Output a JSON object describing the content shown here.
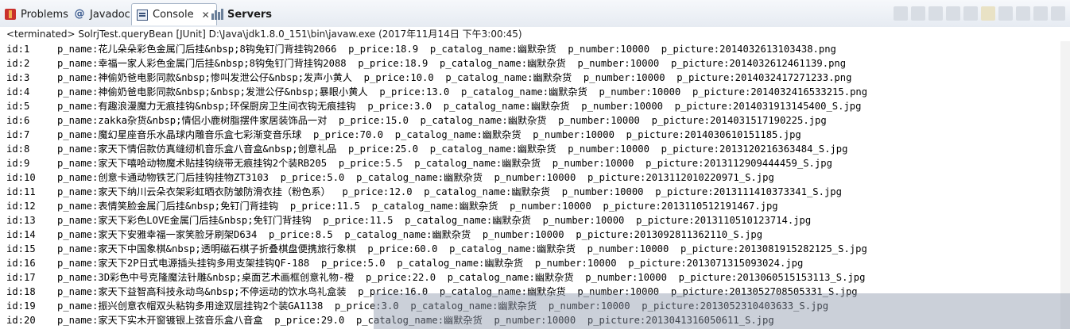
{
  "tabs": [
    {
      "label": "Problems",
      "icon": "problems-icon"
    },
    {
      "label": "Javadoc",
      "icon": "at-icon"
    },
    {
      "label": "Console",
      "icon": "console-icon",
      "active": true
    },
    {
      "label": "Servers",
      "icon": "servers-icon"
    }
  ],
  "status": "<terminated> SolrjTest.queryBean [JUnit] D:\\Java\\jdk1.8.0_151\\bin\\javaw.exe (2017年11月14日 下午3:00:45)",
  "rows": [
    {
      "id": "id:1",
      "name": "p_name:花儿朵朵彩色金属门后挂&nbsp;8钩兔钉门背挂钩2066",
      "price": "p_price:18.9",
      "catalog": "p_catalog_name:幽默杂货",
      "number": "p_number:10000",
      "picture": "p_picture:2014032613103438.png"
    },
    {
      "id": "id:2",
      "name": "p_name:幸福一家人彩色金属门后挂&nbsp;8钩兔钉门背挂钩2088",
      "price": "p_price:18.9",
      "catalog": "p_catalog_name:幽默杂货",
      "number": "p_number:10000",
      "picture": "p_picture:2014032612461139.png"
    },
    {
      "id": "id:3",
      "name": "p_name:神偷奶爸电影同款&nbsp;惨叫发泄公仔&nbsp;发声小黄人",
      "price": "p_price:10.0",
      "catalog": "p_catalog_name:幽默杂货",
      "number": "p_number:10000",
      "picture": "p_picture:2014032417271233.png"
    },
    {
      "id": "id:4",
      "name": "p_name:神偷奶爸电影同款&nbsp;&nbsp;发泄公仔&nbsp;暴眼小黄人",
      "price": "p_price:13.0",
      "catalog": "p_catalog_name:幽默杂货",
      "number": "p_number:10000",
      "picture": "p_picture:2014032416533215.png"
    },
    {
      "id": "id:5",
      "name": "p_name:有趣浪漫魔力无痕挂钩&nbsp;环保厨房卫生间衣钩无痕挂钩",
      "price": "p_price:3.0",
      "catalog": "p_catalog_name:幽默杂货",
      "number": "p_number:10000",
      "picture": "p_picture:2014031913145400_S.jpg"
    },
    {
      "id": "id:6",
      "name": "p_name:zakka杂货&nbsp;情侣小鹿树脂摆件家居装饰品一对",
      "price": "p_price:15.0",
      "catalog": "p_catalog_name:幽默杂货",
      "number": "p_number:10000",
      "picture": "p_picture:2014031517190225.jpg"
    },
    {
      "id": "id:7",
      "name": "p_name:魔幻星座音乐水晶球内雕音乐盒七彩渐变音乐球",
      "price": "p_price:70.0",
      "catalog": "p_catalog_name:幽默杂货",
      "number": "p_number:10000",
      "picture": "p_picture:2014030610151185.jpg"
    },
    {
      "id": "id:8",
      "name": "p_name:家天下情侣款仿真缝纫机音乐盒八音盒&nbsp;创意礼品",
      "price": "p_price:25.0",
      "catalog": "p_catalog_name:幽默杂货",
      "number": "p_number:10000",
      "picture": "p_picture:2013120216363484_S.jpg"
    },
    {
      "id": "id:9",
      "name": "p_name:家天下嘻哈动物魔术贴挂钩绕带无痕挂钩2个装RB205",
      "price": "p_price:5.5",
      "catalog": "p_catalog_name:幽默杂货",
      "number": "p_number:10000",
      "picture": "p_picture:2013112909444459_S.jpg"
    },
    {
      "id": "id:10",
      "name": "p_name:创意卡通动物铁艺门后挂钩挂物ZT3103",
      "price": "p_price:5.0",
      "catalog": "p_catalog_name:幽默杂货",
      "number": "p_number:10000",
      "picture": "p_picture:2013112010220971_S.jpg"
    },
    {
      "id": "id:11",
      "name": "p_name:家天下纳川云朵衣架彩虹晒衣防皱防滑衣挂（粉色系）",
      "price": "p_price:12.0",
      "catalog": "p_catalog_name:幽默杂货",
      "number": "p_number:10000",
      "picture": "p_picture:2013111410373341_S.jpg"
    },
    {
      "id": "id:12",
      "name": "p_name:表情笑脸金属门后挂&nbsp;免钉门背挂钩",
      "price": "p_price:11.5",
      "catalog": "p_catalog_name:幽默杂货",
      "number": "p_number:10000",
      "picture": "p_picture:2013110512191467.jpg"
    },
    {
      "id": "id:13",
      "name": "p_name:家天下彩色LOVE金属门后挂&nbsp;免钉门背挂钩",
      "price": "p_price:11.5",
      "catalog": "p_catalog_name:幽默杂货",
      "number": "p_number:10000",
      "picture": "p_picture:2013110510123714.jpg"
    },
    {
      "id": "id:14",
      "name": "p_name:家天下安雅幸福一家笑脸牙刷架D634",
      "price": "p_price:8.5",
      "catalog": "p_catalog_name:幽默杂货",
      "number": "p_number:10000",
      "picture": "p_picture:2013092811362110_S.jpg"
    },
    {
      "id": "id:15",
      "name": "p_name:家天下中国象棋&nbsp;透明磁石棋子折叠棋盘便携旅行象棋",
      "price": "p_price:60.0",
      "catalog": "p_catalog_name:幽默杂货",
      "number": "p_number:10000",
      "picture": "p_picture:2013081915282125_S.jpg"
    },
    {
      "id": "id:16",
      "name": "p_name:家天下2P日式电源插头挂钩多用支架挂钩QF-188",
      "price": "p_price:5.0",
      "catalog": "p_catalog_name:幽默杂货",
      "number": "p_number:10000",
      "picture": "p_picture:2013071315093024.jpg"
    },
    {
      "id": "id:17",
      "name": "p_name:3D彩色中号克隆魔法针雕&nbsp;桌面艺术画框创意礼物-橙",
      "price": "p_price:22.0",
      "catalog": "p_catalog_name:幽默杂货",
      "number": "p_number:10000",
      "picture": "p_picture:2013060515153113_S.jpg"
    },
    {
      "id": "id:18",
      "name": "p_name:家天下益智高科技永动鸟&nbsp;不停运动的饮水鸟礼盒装",
      "price": "p_price:16.0",
      "catalog": "p_catalog_name:幽默杂货",
      "number": "p_number:10000",
      "picture": "p_picture:2013052708505331_S.jpg"
    },
    {
      "id": "id:19",
      "name": "p_name:振兴创意衣帽双头粘钩多用途双层挂钩2个装GA1138",
      "price": "p_price:3.0",
      "catalog": "p_catalog_name:幽默杂货",
      "number": "p_number:10000",
      "picture": "p_picture:2013052310403633_S.jpg"
    },
    {
      "id": "id:20",
      "name": "p_name:家天下实木开窗镀银上弦音乐盒八音盒",
      "price": "p_price:29.0",
      "catalog": "p_catalog_name:幽默杂货",
      "number": "p_number:10000",
      "picture": "p_picture:2013041316050611_S.jpg"
    }
  ]
}
